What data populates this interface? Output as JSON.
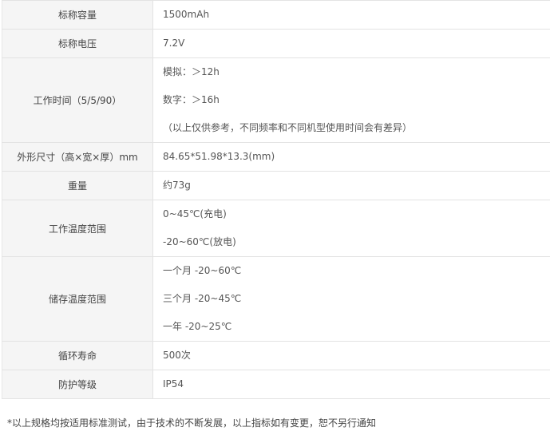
{
  "specs": [
    {
      "label": "标称容量",
      "values": [
        "1500mAh"
      ]
    },
    {
      "label": "标称电压",
      "values": [
        "7.2V"
      ]
    },
    {
      "label": "工作时间（5/5/90）",
      "values": [
        "模拟：＞12h",
        "数字：＞16h",
        "（以上仅供参考，不同频率和不同机型使用时间会有差异）"
      ]
    },
    {
      "label": "外形尺寸（高×宽×厚）mm",
      "values": [
        "84.65*51.98*13.3(mm)"
      ]
    },
    {
      "label": "重量",
      "values": [
        "约73g"
      ]
    },
    {
      "label": "工作温度范围",
      "values": [
        "0~45℃(充电)",
        "-20~60℃(放电)"
      ]
    },
    {
      "label": "储存温度范围",
      "values": [
        "一个月 -20~60℃",
        "三个月 -20~45℃",
        "一年 -20~25℃"
      ]
    },
    {
      "label": "循环寿命",
      "values": [
        "500次"
      ]
    },
    {
      "label": "防护等级",
      "values": [
        "IP54"
      ]
    }
  ],
  "footnote": "*以上规格均按适用标准测试，由于技术的不断发展，以上指标如有变更，恕不另行通知"
}
